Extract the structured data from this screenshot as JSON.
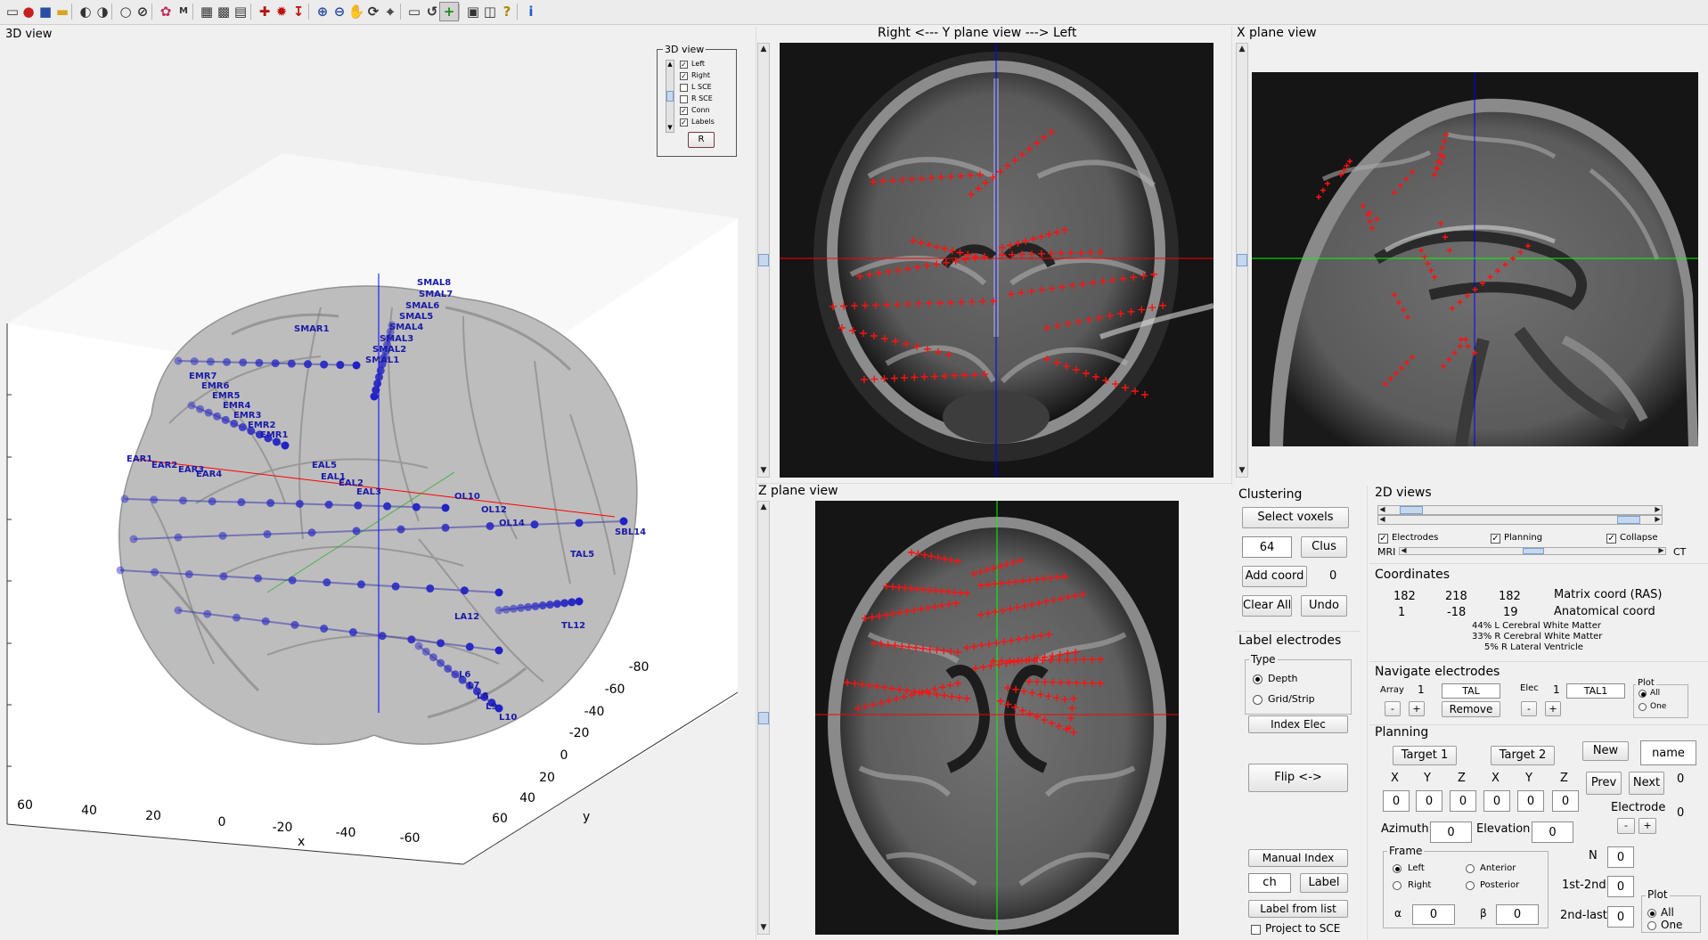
{
  "window": {
    "title": ""
  },
  "toolbar": {
    "tools": [
      {
        "name": "new-icon",
        "x": 3
      },
      {
        "name": "brain-red-icon",
        "x": 21
      },
      {
        "name": "save-icon",
        "x": 40
      },
      {
        "name": "open-folder-icon",
        "x": 59
      },
      {
        "name": "brain-outline-icon",
        "x": 85
      },
      {
        "name": "brain-crossed-icon",
        "x": 104
      },
      {
        "name": "lasso-icon",
        "x": 130
      },
      {
        "name": "lasso-crossed-icon",
        "x": 149
      },
      {
        "name": "color-wheel-icon",
        "x": 175
      },
      {
        "name": "mri-icon",
        "x": 195
      },
      {
        "name": "grid-icon",
        "x": 221
      },
      {
        "name": "grid-fine-icon",
        "x": 240
      },
      {
        "name": "document-icon",
        "x": 259
      },
      {
        "name": "electrodes-icon",
        "x": 286
      },
      {
        "name": "brain-electrodes-icon",
        "x": 305
      },
      {
        "name": "electrode-insert-icon",
        "x": 324
      },
      {
        "name": "zoom-in-icon",
        "x": 351
      },
      {
        "name": "zoom-out-icon",
        "x": 370
      },
      {
        "name": "pan-hand-icon",
        "x": 389
      },
      {
        "name": "rotate-3d-icon",
        "x": 408
      },
      {
        "name": "data-cursor-icon",
        "x": 427
      },
      {
        "name": "colorbar-icon",
        "x": 454
      },
      {
        "name": "link-icon",
        "x": 474
      },
      {
        "name": "add-plot-icon",
        "x": 493,
        "active": true
      },
      {
        "name": "window-icon",
        "x": 520
      },
      {
        "name": "window-split-icon",
        "x": 539
      },
      {
        "name": "help-icon",
        "x": 558
      },
      {
        "name": "info-icon",
        "x": 585
      }
    ],
    "mri_label": "MRI"
  },
  "views": {
    "view3d_title": "3D view",
    "yplane_title": "Right <---       Y plane view        ---> Left",
    "xplane_title": "X plane view",
    "zplane_title": "Z plane view"
  },
  "view3d": {
    "legend_title": "3D view",
    "legend_items": [
      {
        "label": "Left",
        "checked": true
      },
      {
        "label": "Right",
        "checked": true
      },
      {
        "label": "L SCE",
        "checked": false
      },
      {
        "label": "R SCE",
        "checked": false
      },
      {
        "label": "Conn",
        "checked": true
      },
      {
        "label": "Labels",
        "checked": true
      }
    ],
    "legend_button": "R",
    "x_ticks": [
      "60",
      "40",
      "20",
      "0",
      "-20",
      "-40",
      "-60"
    ],
    "x_axis_label": "x",
    "y_ticks": [
      "60",
      "40",
      "20",
      "0",
      "-20",
      "-40",
      "-60",
      "-80"
    ],
    "y_axis_label": "y",
    "electrode_labels": [
      "SMAL8",
      "SMAL7",
      "SMAL6",
      "SMAL5",
      "SMAL4",
      "SMAL3",
      "SMAL2",
      "SMAL1",
      "SMAR1",
      "EMR7",
      "EMR6",
      "EMR5",
      "EMR4",
      "EMR3",
      "EMR2",
      "EMR1",
      "EAR1",
      "EAR2",
      "EAR3",
      "EAR4",
      "EAL5",
      "EAL1",
      "EAL2",
      "EAL3",
      "OL10",
      "OL12",
      "OL14",
      "SBL14",
      "TAL5",
      "LA12",
      "TL12",
      "L6",
      "L7",
      "L8",
      "L9",
      "L10"
    ]
  },
  "colors": {
    "marker": "#ff0000",
    "crosshair_v": "#0000ff",
    "crosshair_h": "#ff0000",
    "crosshair_green": "#00ff00",
    "accent": "#7aa0cc",
    "electrode_blue": "#2020c8"
  },
  "clustering": {
    "title": "Clustering",
    "select_voxels": "Select voxels",
    "cluster_size": "64",
    "clus": "Clus",
    "add_coord": "Add coord",
    "coord_count": "0",
    "clear_all": "Clear All",
    "undo": "Undo"
  },
  "label_electrodes": {
    "title": "Label electrodes",
    "type_title": "Type",
    "depth": "Depth",
    "grid_strip": "Grid/Strip",
    "index_elec": "Index Elec",
    "flip": "Flip <->",
    "manual_index": "Manual Index",
    "label_input": "ch",
    "label_button": "Label",
    "label_from_list": "Label from list",
    "project_to_sce": "Project to SCE"
  },
  "views2d": {
    "title": "2D views",
    "electrodes": "Electrodes",
    "planning": "Planning",
    "collapse": "Collapse",
    "mri": "MRI",
    "ct": "CT"
  },
  "coordinates": {
    "title": "Coordinates",
    "matrix": [
      "182",
      "218",
      "182"
    ],
    "matrix_label": "Matrix coord (RAS)",
    "anatomical": [
      "1",
      "-18",
      "19"
    ],
    "anatomical_label": "Anatomical coord",
    "atlas_lines": [
      "44% L Cerebral White Matter",
      "33% R Cerebral White Matter",
      "5% R Lateral Ventricle"
    ]
  },
  "navigate": {
    "title": "Navigate electrodes",
    "array_label": "Array",
    "array_value": "1",
    "array_name": "TAL",
    "elec_label": "Elec",
    "elec_value": "1",
    "elec_name": "TAL1",
    "minus": "-",
    "plus": "+",
    "remove": "Remove",
    "plot_title": "Plot",
    "all": "All",
    "one": "One"
  },
  "planning": {
    "title": "Planning",
    "target1": "Target 1",
    "target2": "Target 2",
    "new": "New",
    "name_input": "name",
    "headers": [
      "X",
      "Y",
      "Z",
      "X",
      "Y",
      "Z"
    ],
    "values": [
      "0",
      "0",
      "0",
      "0",
      "0",
      "0"
    ],
    "prev": "Prev",
    "next": "Next",
    "next_count": "0",
    "electrode_label": "Electrode",
    "electrode_count": "0",
    "minus": "-",
    "plus": "+",
    "azimuth_label": "Azimuth",
    "azimuth_value": "0",
    "elevation_label": "Elevation",
    "elevation_value": "0",
    "frame_title": "Frame",
    "frame_left": "Left",
    "frame_right": "Right",
    "frame_anterior": "Anterior",
    "frame_posterior": "Posterior",
    "alpha_label": "α",
    "alpha_value": "0",
    "beta_label": "β",
    "beta_value": "0",
    "n_label": "N",
    "n_value": "0",
    "first_second_label": "1st-2nd",
    "first_second_value": "0",
    "second_last_label": "2nd-last",
    "second_last_value": "0",
    "plot_title": "Plot",
    "all": "All",
    "one": "One"
  }
}
